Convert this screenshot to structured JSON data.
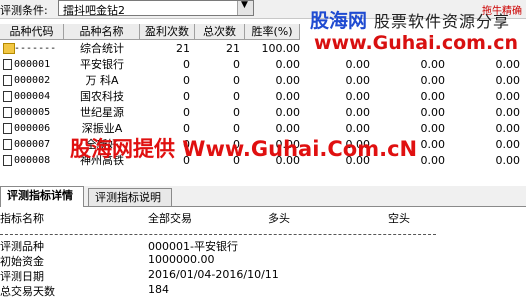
{
  "condition": {
    "label": "评测条件:",
    "value": "擂抖吧金钻2",
    "dropdown_icon": "chevron-down-icon"
  },
  "corner_text": "拖牛精确",
  "grid": {
    "columns": [
      "品种代码",
      "品种名称",
      "盈利次数",
      "总次数",
      "胜率(%)"
    ],
    "rows": [
      {
        "code": "-------",
        "name": "综合统计",
        "wins": "21",
        "total": "21",
        "rate": "100.00",
        "c6": "",
        "c7": "",
        "c8": ""
      },
      {
        "code": "000001",
        "name": "平安银行",
        "wins": "0",
        "total": "0",
        "rate": "0.00",
        "c6": "0.00",
        "c7": "0.00",
        "c8": "0.00"
      },
      {
        "code": "000002",
        "name": "万 科A",
        "wins": "0",
        "total": "0",
        "rate": "0.00",
        "c6": "0.00",
        "c7": "0.00",
        "c8": "0.00"
      },
      {
        "code": "000004",
        "name": "国农科技",
        "wins": "0",
        "total": "0",
        "rate": "0.00",
        "c6": "0.00",
        "c7": "0.00",
        "c8": "0.00"
      },
      {
        "code": "000005",
        "name": "世纪星源",
        "wins": "0",
        "total": "0",
        "rate": "0.00",
        "c6": "0.00",
        "c7": "0.00",
        "c8": "0.00"
      },
      {
        "code": "000006",
        "name": "深振业A",
        "wins": "0",
        "total": "0",
        "rate": "0.00",
        "c6": "0.00",
        "c7": "0.00",
        "c8": "0.00"
      },
      {
        "code": "000007",
        "name": "全新好",
        "wins": "0",
        "total": "0",
        "rate": "0.00",
        "c6": "0.00",
        "c7": "0.00",
        "c8": "0.00"
      },
      {
        "code": "000008",
        "name": "神州高铁",
        "wins": "0",
        "total": "0",
        "rate": "0.00",
        "c6": "0.00",
        "c7": "0.00",
        "c8": "0.00"
      }
    ]
  },
  "tabs": [
    "评测指标详情",
    "评测指标说明"
  ],
  "detail": {
    "headers": [
      "指标名称",
      "全部交易",
      "多头",
      "空头"
    ],
    "rows": [
      {
        "label": "评测品种",
        "value": "000001-平安银行"
      },
      {
        "label": "初始资金",
        "value": "1000000.00"
      },
      {
        "label": "评测日期",
        "value": "2016/01/04-2016/10/11"
      },
      {
        "label": "总交易天数",
        "value": "184"
      }
    ]
  },
  "watermarks": {
    "logo": "股海网",
    "title": "股票软件资源分享",
    "url": "www.Guhai.com.cn",
    "overlay": "股海网提供 Www.Guhai.Com.cN"
  }
}
